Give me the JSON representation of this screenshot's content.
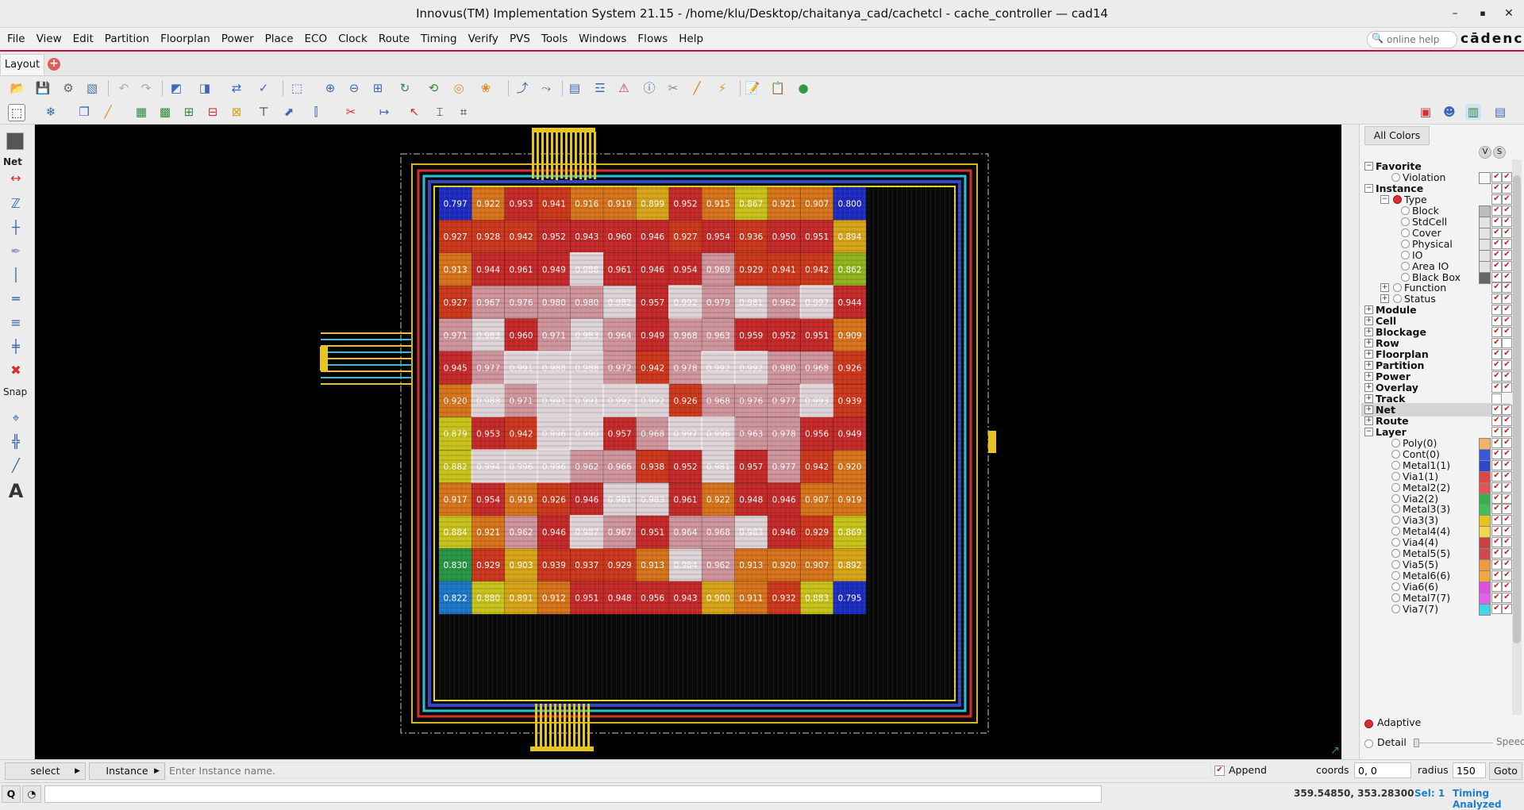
{
  "window": {
    "title": "Innovus(TM) Implementation System 21.15 - /home/klu/Desktop/chaitanya_cad/cachetcl - cache_controller — cad14",
    "minimize": "–",
    "maximize": "▪",
    "close": "✕"
  },
  "menubar": {
    "items": [
      "File",
      "Edit",
      "Partition",
      "Floorplan",
      "Power",
      "Place",
      "ECO",
      "Clock",
      "Route",
      "Timing",
      "Verify",
      "PVS",
      "Tools",
      "Windows",
      "Flows",
      "Help"
    ],
    "view_item": "View",
    "help_search_placeholder": "online help",
    "brand": "cādence"
  },
  "tabs": {
    "active": "Layout",
    "add_symbol": "+"
  },
  "lefttools": {
    "net_label": "Net",
    "snap_label": "Snap",
    "text_tool": "A"
  },
  "layout": {
    "congestion_grid": [
      [
        "0.797",
        "0.922",
        "0.953",
        "0.941",
        "0.916",
        "0.919",
        "0.899",
        "0.952",
        "0.915",
        "0.867",
        "0.921",
        "0.907",
        "0.800"
      ],
      [
        "0.927",
        "0.928",
        "0.942",
        "0.952",
        "0.943",
        "0.960",
        "0.946",
        "0.927",
        "0.954",
        "0.936",
        "0.950",
        "0.951",
        "0.894"
      ],
      [
        "0.913",
        "0.944",
        "0.961",
        "0.949",
        "0.988",
        "0.961",
        "0.946",
        "0.954",
        "0.969",
        "0.929",
        "0.941",
        "0.942",
        "0.862"
      ],
      [
        "0.927",
        "0.967",
        "0.976",
        "0.980",
        "0.980",
        "0.982",
        "0.957",
        "0.992",
        "0.979",
        "0.981",
        "0.962",
        "0.997",
        "0.944"
      ],
      [
        "0.971",
        "0.983",
        "0.960",
        "0.971",
        "0.983",
        "0.964",
        "0.949",
        "0.968",
        "0.963",
        "0.959",
        "0.952",
        "0.951",
        "0.909"
      ],
      [
        "0.945",
        "0.977",
        "0.991",
        "0.988",
        "0.988",
        "0.972",
        "0.942",
        "0.978",
        "0.992",
        "0.992",
        "0.980",
        "0.968",
        "0.926"
      ],
      [
        "0.920",
        "0.988",
        "0.971",
        "0.991",
        "0.991",
        "0.992",
        "0.992",
        "0.926",
        "0.968",
        "0.976",
        "0.977",
        "0.993",
        "0.939"
      ],
      [
        "0.879",
        "0.953",
        "0.942",
        "0.996",
        "0.990",
        "0.957",
        "0.968",
        "0.997",
        "0.996",
        "0.963",
        "0.978",
        "0.956",
        "0.949"
      ],
      [
        "0.882",
        "0.994",
        "0.996",
        "0.996",
        "0.962",
        "0.966",
        "0.938",
        "0.952",
        "0.981",
        "0.957",
        "0.977",
        "0.942",
        "0.920"
      ],
      [
        "0.917",
        "0.954",
        "0.919",
        "0.926",
        "0.946",
        "0.981",
        "0.983",
        "0.961",
        "0.922",
        "0.948",
        "0.946",
        "0.907",
        "0.919"
      ],
      [
        "0.884",
        "0.921",
        "0.962",
        "0.946",
        "0.987",
        "0.967",
        "0.951",
        "0.964",
        "0.968",
        "0.983",
        "0.946",
        "0.929",
        "0.869"
      ],
      [
        "0.830",
        "0.929",
        "0.903",
        "0.939",
        "0.937",
        "0.929",
        "0.913",
        "0.984",
        "0.962",
        "0.913",
        "0.920",
        "0.907",
        "0.892"
      ],
      [
        "0.822",
        "0.880",
        "0.891",
        "0.912",
        "0.951",
        "0.948",
        "0.956",
        "0.943",
        "0.900",
        "0.911",
        "0.932",
        "0.883",
        "0.795"
      ]
    ],
    "palette": [
      "#1e2fd0",
      "#1f7fd8",
      "#2aa34a",
      "#9bc21e",
      "#d8d21c",
      "#e9b21a",
      "#e77d1d",
      "#dc3c1e",
      "#d42c2c",
      "#e0a0a8",
      "#f1e6ea"
    ]
  },
  "panel": {
    "all_colors": "All Colors",
    "v": "V",
    "s": "S",
    "tree": [
      {
        "label": "Favorite",
        "level": 0,
        "bold": true,
        "expander": "minus"
      },
      {
        "label": "Violation",
        "level": 2,
        "radio": "off",
        "swatch": "#f7f7f7",
        "c1": true,
        "c2": true
      },
      {
        "label": "Instance",
        "level": 0,
        "bold": true,
        "expander": "minus",
        "c1": true,
        "c2": true
      },
      {
        "label": "Type",
        "level": 1,
        "expander": "minus",
        "radio": "on",
        "c1": true,
        "c2": true
      },
      {
        "label": "Block",
        "level": 3,
        "radio": "off",
        "swatch": "#bdbdbd",
        "c1": true,
        "c2": true
      },
      {
        "label": "StdCell",
        "level": 3,
        "radio": "off",
        "swatch": "#e3e3e3",
        "c1": true,
        "c2": true
      },
      {
        "label": "Cover",
        "level": 3,
        "radio": "off",
        "swatch": "#e3e3e3",
        "c1": true,
        "c2": true
      },
      {
        "label": "Physical",
        "level": 3,
        "radio": "off",
        "swatch": "#e3e3e3",
        "c1": true,
        "c2": true
      },
      {
        "label": "IO",
        "level": 3,
        "radio": "off",
        "swatch": "#e3e3e3",
        "c1": true,
        "c2": true
      },
      {
        "label": "Area IO",
        "level": 3,
        "radio": "off",
        "swatch": "#e3e3e3",
        "c1": true,
        "c2": true
      },
      {
        "label": "Black Box",
        "level": 3,
        "radio": "off",
        "swatch": "#666666",
        "c1": true,
        "c2": true
      },
      {
        "label": "Function",
        "level": 1,
        "expander": "plus",
        "radio": "off",
        "c1": true,
        "c2": true
      },
      {
        "label": "Status",
        "level": 1,
        "expander": "plus",
        "radio": "off",
        "c1": true,
        "c2": true
      },
      {
        "label": "Module",
        "level": 0,
        "bold": true,
        "expander": "plus",
        "c1": true,
        "c2": true
      },
      {
        "label": "Cell",
        "level": 0,
        "bold": true,
        "expander": "plus",
        "c1": true,
        "c2": true
      },
      {
        "label": "Blockage",
        "level": 0,
        "bold": true,
        "expander": "plus",
        "c1": true,
        "c2": true
      },
      {
        "label": "Row",
        "level": 0,
        "bold": true,
        "expander": "plus",
        "c1": true,
        "c2": false
      },
      {
        "label": "Floorplan",
        "level": 0,
        "bold": true,
        "expander": "plus",
        "c1": true,
        "c2": true
      },
      {
        "label": "Partition",
        "level": 0,
        "bold": true,
        "expander": "plus",
        "c1": true,
        "c2": true
      },
      {
        "label": "Power",
        "level": 0,
        "bold": true,
        "expander": "plus",
        "c1": true,
        "c2": true
      },
      {
        "label": "Overlay",
        "level": 0,
        "bold": true,
        "expander": "plus",
        "c1": true,
        "c2": true
      },
      {
        "label": "Track",
        "level": 0,
        "bold": true,
        "expander": "plus",
        "c1": false,
        "c2": null
      },
      {
        "label": "Net",
        "level": 0,
        "bold": true,
        "expander": "plus",
        "c1": true,
        "c2": true,
        "selected": true
      },
      {
        "label": "Route",
        "level": 0,
        "bold": true,
        "expander": "plus",
        "c1": true,
        "c2": true
      },
      {
        "label": "Layer",
        "level": 0,
        "bold": true,
        "expander": "minus",
        "c1": true,
        "c2": true
      },
      {
        "label": "Poly(0)",
        "level": 2,
        "radio": "off",
        "swatch": "#f2b26a",
        "c1": true,
        "c2": true
      },
      {
        "label": "Cont(0)",
        "level": 2,
        "radio": "off",
        "swatch": "#3a57d8",
        "c1": true,
        "c2": true
      },
      {
        "label": "Metal1(1)",
        "level": 2,
        "radio": "off",
        "swatch": "#2f47c8",
        "c1": true,
        "c2": true
      },
      {
        "label": "Via1(1)",
        "level": 2,
        "radio": "off",
        "swatch": "#e04646",
        "c1": true,
        "c2": true
      },
      {
        "label": "Metal2(2)",
        "level": 2,
        "radio": "off",
        "swatch": "#e35454",
        "c1": true,
        "c2": true
      },
      {
        "label": "Via2(2)",
        "level": 2,
        "radio": "off",
        "swatch": "#38b04a",
        "c1": true,
        "c2": true
      },
      {
        "label": "Metal3(3)",
        "level": 2,
        "radio": "off",
        "swatch": "#3fbf56",
        "c1": true,
        "c2": true
      },
      {
        "label": "Via3(3)",
        "level": 2,
        "radio": "off",
        "swatch": "#e8c51e",
        "c1": true,
        "c2": true
      },
      {
        "label": "Metal4(4)",
        "level": 2,
        "radio": "off",
        "swatch": "#f0d84a",
        "c1": true,
        "c2": true
      },
      {
        "label": "Via4(4)",
        "level": 2,
        "radio": "off",
        "swatch": "#c84040",
        "c1": true,
        "c2": true
      },
      {
        "label": "Metal5(5)",
        "level": 2,
        "radio": "off",
        "swatch": "#d04a4a",
        "c1": true,
        "c2": true
      },
      {
        "label": "Via5(5)",
        "level": 2,
        "radio": "off",
        "swatch": "#f09a3a",
        "c1": true,
        "c2": true
      },
      {
        "label": "Metal6(6)",
        "level": 2,
        "radio": "off",
        "swatch": "#f2a640",
        "c1": true,
        "c2": true
      },
      {
        "label": "Via6(6)",
        "level": 2,
        "radio": "off",
        "swatch": "#e050e0",
        "c1": true,
        "c2": true
      },
      {
        "label": "Metal7(7)",
        "level": 2,
        "radio": "off",
        "swatch": "#e060e8",
        "c1": true,
        "c2": true
      },
      {
        "label": "Via7(7)",
        "level": 2,
        "radio": "off",
        "swatch": "#40d8e0",
        "c1": true,
        "c2": true
      }
    ],
    "mode_adaptive": "Adaptive",
    "mode_detail": "Detail",
    "speed_label": "Speed"
  },
  "statusbar": {
    "select_mode": "select",
    "object_type": "Instance",
    "search_placeholder": "Enter Instance name.",
    "append_label": "Append",
    "coords_label": "coords",
    "coords_value": "0, 0",
    "radius_label": "radius",
    "radius_value": "150",
    "goto_label": "Goto",
    "q_label": "Q",
    "cursor_coords": "359.54850, 353.28300",
    "selection": "Sel: 1",
    "timing_status": "Timing Analyzed"
  }
}
